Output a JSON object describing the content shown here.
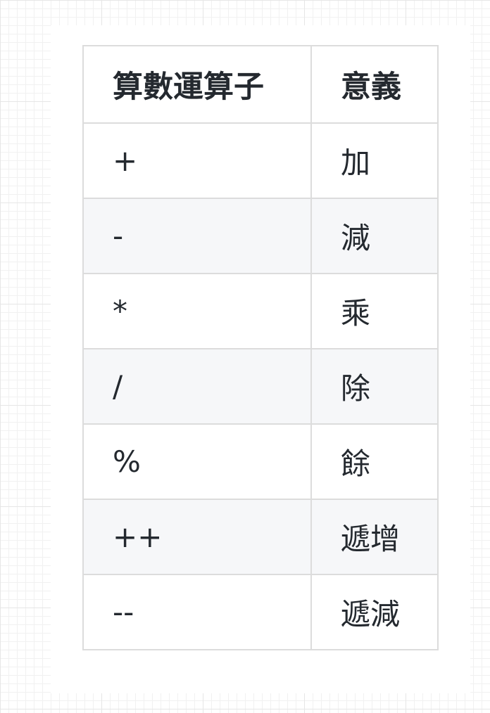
{
  "table": {
    "headers": [
      "算數運算子",
      "意義"
    ],
    "rows": [
      {
        "operator": "+",
        "meaning": "加"
      },
      {
        "operator": "-",
        "meaning": "減"
      },
      {
        "operator": "*",
        "meaning": "乘"
      },
      {
        "operator": "/",
        "meaning": "除"
      },
      {
        "operator": "%",
        "meaning": "餘"
      },
      {
        "operator": "++",
        "meaning": "遞增"
      },
      {
        "operator": "--",
        "meaning": "遞減"
      }
    ]
  }
}
